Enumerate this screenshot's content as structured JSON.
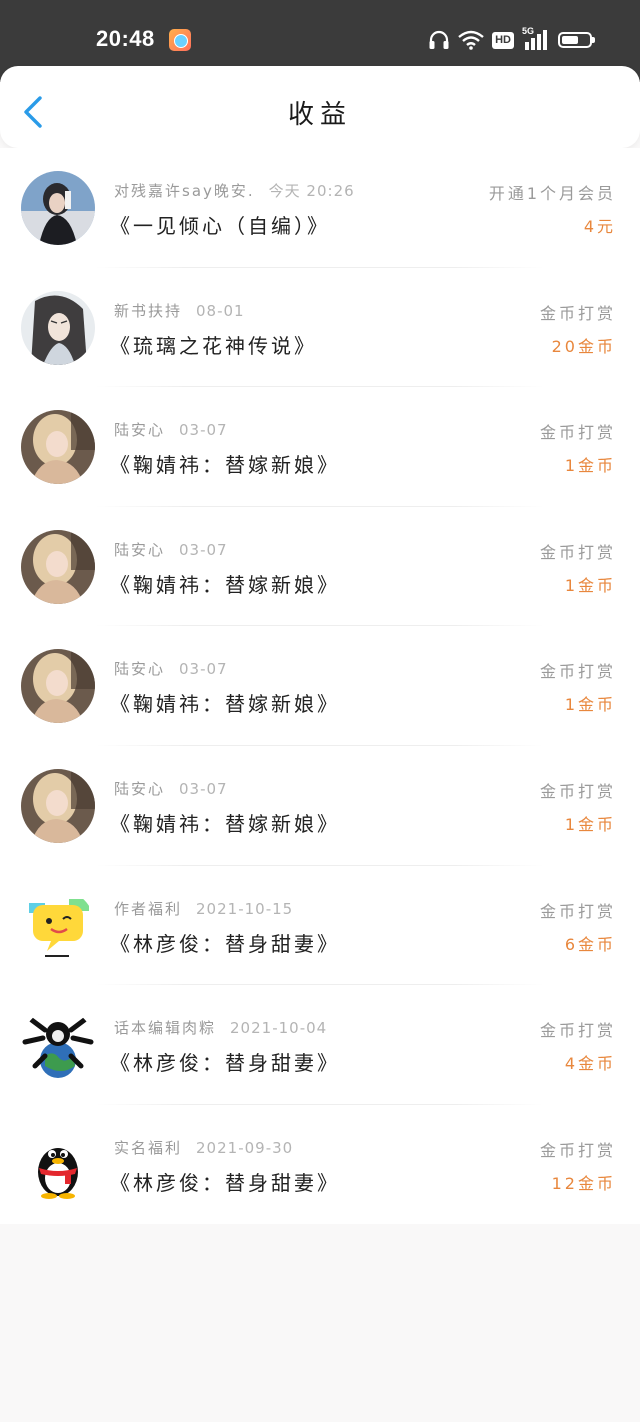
{
  "status_bar": {
    "time": "20:48",
    "hd_label": "HD",
    "network_label": "5G",
    "battery_level": 0.6
  },
  "header": {
    "title": "收益"
  },
  "colors": {
    "accent": "#2a9be8",
    "amount": "#e8873d",
    "status_bar": "#3b3b3b"
  },
  "items": [
    {
      "source": "对残嘉许say晚安.",
      "date": "今天 20:26",
      "book": "《一见倾心（自编）》",
      "type": "开通1个月会员",
      "amount": "4元",
      "avatar": "avatar-girl-dark"
    },
    {
      "source": "新书扶持",
      "date": "08-01",
      "book": "《琉璃之花神传说》",
      "type": "金币打赏",
      "amount": "20金币",
      "avatar": "avatar-ancient-man"
    },
    {
      "source": "陆安心",
      "date": "03-07",
      "book": "《鞠婧祎：替嫁新娘》",
      "type": "金币打赏",
      "amount": "1金币",
      "avatar": "avatar-blonde-girl"
    },
    {
      "source": "陆安心",
      "date": "03-07",
      "book": "《鞠婧祎：替嫁新娘》",
      "type": "金币打赏",
      "amount": "1金币",
      "avatar": "avatar-blonde-girl"
    },
    {
      "source": "陆安心",
      "date": "03-07",
      "book": "《鞠婧祎：替嫁新娘》",
      "type": "金币打赏",
      "amount": "1金币",
      "avatar": "avatar-blonde-girl"
    },
    {
      "source": "陆安心",
      "date": "03-07",
      "book": "《鞠婧祎：替嫁新娘》",
      "type": "金币打赏",
      "amount": "1金币",
      "avatar": "avatar-blonde-girl"
    },
    {
      "source": "作者福利",
      "date": "2021-10-15",
      "book": "《林彦俊：替身甜妻》",
      "type": "金币打赏",
      "amount": "6金币",
      "avatar": "avatar-yellow-bubble"
    },
    {
      "source": "话本编辑肉粽",
      "date": "2021-10-04",
      "book": "《林彦俊：替身甜妻》",
      "type": "金币打赏",
      "amount": "4金币",
      "avatar": "avatar-globe-skull"
    },
    {
      "source": "实名福利",
      "date": "2021-09-30",
      "book": "《林彦俊：替身甜妻》",
      "type": "金币打赏",
      "amount": "12金币",
      "avatar": "avatar-qq-penguin"
    }
  ]
}
